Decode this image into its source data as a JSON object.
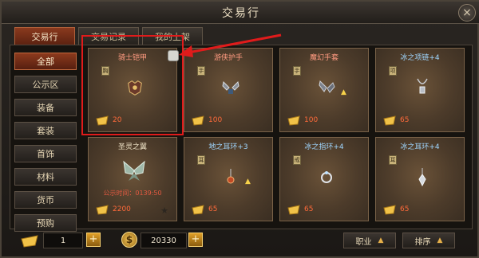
{
  "window": {
    "title": "交易行",
    "close_icon": "×"
  },
  "tabs": [
    {
      "label": "交易行",
      "active": true
    },
    {
      "label": "交易记录",
      "active": false
    },
    {
      "label": "我的上架",
      "active": false
    }
  ],
  "sidebar": {
    "items": [
      {
        "label": "全部",
        "active": true
      },
      {
        "label": "公示区",
        "active": false
      },
      {
        "label": "装备",
        "active": false
      },
      {
        "label": "套装",
        "active": false
      },
      {
        "label": "首饰",
        "active": false
      },
      {
        "label": "材料",
        "active": false
      },
      {
        "label": "货币",
        "active": false
      },
      {
        "label": "预购",
        "active": false
      }
    ]
  },
  "items": [
    {
      "name": "骑士铠甲",
      "price": "20",
      "icon": "armor-icon",
      "badge": "胸",
      "name_color": "red"
    },
    {
      "name": "游侠护手",
      "price": "100",
      "icon": "gauntlet-icon",
      "badge": "手",
      "name_color": "red"
    },
    {
      "name": "魔幻手套",
      "price": "100",
      "icon": "glove-icon",
      "badge": "手",
      "name_color": "red",
      "upgrade": "▲"
    },
    {
      "name": "冰之项链+4",
      "price": "65",
      "icon": "necklace-icon",
      "badge": "项",
      "name_color": "blue"
    },
    {
      "name": "圣灵之翼",
      "price": "2200",
      "icon": "wings-icon",
      "timer": "公示时间：0139:50",
      "name_color": "plain",
      "star": "★"
    },
    {
      "name": "地之耳环+3",
      "price": "65",
      "icon": "earring-icon",
      "badge": "耳",
      "name_color": "blue",
      "upgrade": "▲"
    },
    {
      "name": "冰之指环+4",
      "price": "65",
      "icon": "ring-icon",
      "badge": "戒",
      "name_color": "blue"
    },
    {
      "name": "冰之耳环+4",
      "price": "65",
      "icon": "earring-icon",
      "badge": "耳",
      "name_color": "blue"
    }
  ],
  "bottom": {
    "quantity": "1",
    "plus_label": "+",
    "currency_symbol": "$",
    "balance": "20330",
    "profession_label": "职业",
    "sort_label": "排序",
    "sort_arrow": "▲"
  },
  "colors": {
    "accent": "#8c3a1d",
    "highlight": "#e01b1b",
    "price": "#ff6a3a"
  }
}
